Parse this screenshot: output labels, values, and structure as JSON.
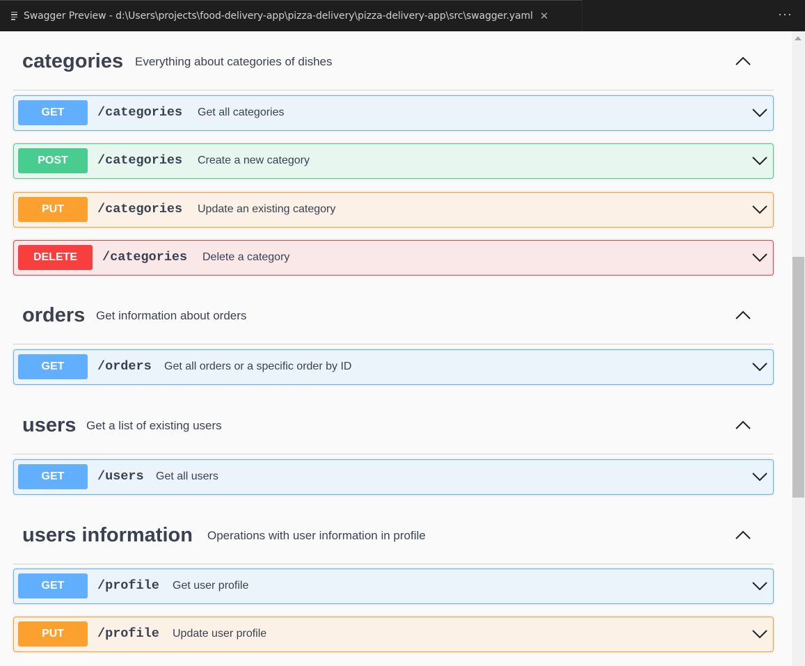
{
  "tab": {
    "title": "Swagger Preview - d:\\Users\\projects\\food-delivery-app\\pizza-delivery\\pizza-delivery-app\\src\\swagger.yaml",
    "close": "✕",
    "more": "···"
  },
  "sections": [
    {
      "name": "categories",
      "description": "Everything about categories of dishes",
      "operations": [
        {
          "method": "GET",
          "path": "/categories",
          "summary": "Get all categories"
        },
        {
          "method": "POST",
          "path": "/categories",
          "summary": "Create a new category"
        },
        {
          "method": "PUT",
          "path": "/categories",
          "summary": "Update an existing category"
        },
        {
          "method": "DELETE",
          "path": "/categories",
          "summary": "Delete a category"
        }
      ]
    },
    {
      "name": "orders",
      "description": "Get information about orders",
      "operations": [
        {
          "method": "GET",
          "path": "/orders",
          "summary": "Get all orders or a specific order by ID"
        }
      ]
    },
    {
      "name": "users",
      "description": "Get a list of existing users",
      "operations": [
        {
          "method": "GET",
          "path": "/users",
          "summary": "Get all users"
        }
      ]
    },
    {
      "name": "users information",
      "description": "Operations with user information in profile",
      "operations": [
        {
          "method": "GET",
          "path": "/profile",
          "summary": "Get user profile"
        },
        {
          "method": "PUT",
          "path": "/profile",
          "summary": "Update user profile"
        }
      ]
    }
  ],
  "colors": {
    "get": "#61affe",
    "post": "#49cc90",
    "put": "#fca130",
    "delete": "#f93e3e",
    "text": "#3b4151"
  }
}
